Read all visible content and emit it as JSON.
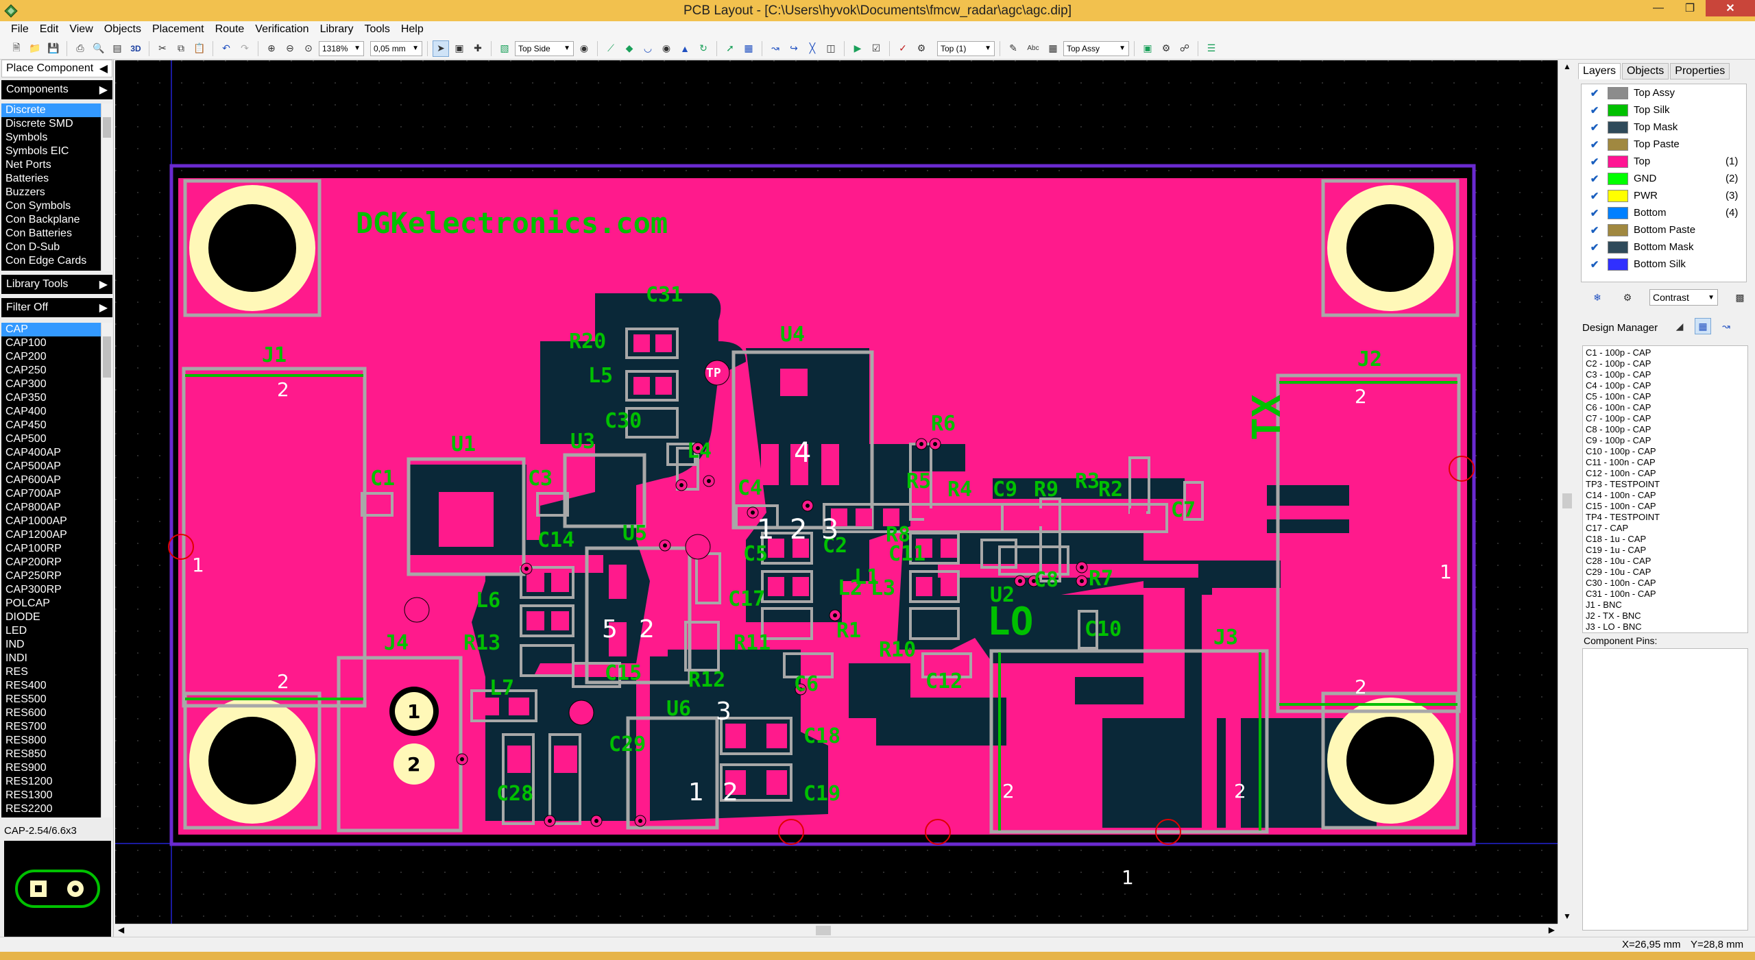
{
  "window": {
    "title": "PCB Layout - [C:\\Users\\hyvok\\Documents\\fmcw_radar\\agc\\agc.dip]"
  },
  "menu": [
    "File",
    "Edit",
    "View",
    "Objects",
    "Placement",
    "Route",
    "Verification",
    "Library",
    "Tools",
    "Help"
  ],
  "toolbar": {
    "zoom": "1318%",
    "grid": "0,05 mm",
    "view_3d": "3D",
    "side": "Top Side",
    "layer": "Top (1)",
    "assy": "Top Assy",
    "abc": "Abc"
  },
  "left_panel": {
    "place_component": "Place Component",
    "components_header": "Components",
    "categories": [
      "Discrete",
      "Discrete SMD",
      "Symbols",
      "Symbols EIC",
      "Net Ports",
      "Batteries",
      "Buzzers",
      "Con Symbols",
      "Con Backplane",
      "Con Batteries",
      "Con D-Sub",
      "Con Edge Cards"
    ],
    "selected_category": "Discrete",
    "library_tools": "Library Tools",
    "filter": "Filter Off",
    "parts": [
      "CAP",
      "CAP100",
      "CAP200",
      "CAP250",
      "CAP300",
      "CAP350",
      "CAP400",
      "CAP450",
      "CAP500",
      "CAP400AP",
      "CAP500AP",
      "CAP600AP",
      "CAP700AP",
      "CAP800AP",
      "CAP1000AP",
      "CAP1200AP",
      "CAP100RP",
      "CAP200RP",
      "CAP250RP",
      "CAP300RP",
      "POLCAP",
      "DIODE",
      "LED",
      "IND",
      "INDI",
      "RES",
      "RES400",
      "RES500",
      "RES600",
      "RES700",
      "RES800",
      "RES850",
      "RES900",
      "RES1200",
      "RES1300",
      "RES2200"
    ],
    "selected_part": "CAP",
    "preview_label": "CAP-2.54/6.6x3"
  },
  "board": {
    "watermark": "DGKelectronics.com",
    "tx_label": "TX",
    "lo_label": "LO",
    "refdes": [
      "J1",
      "J2",
      "J3",
      "J4",
      "U1",
      "U2",
      "U3",
      "U4",
      "U5",
      "U6",
      "C1",
      "C2",
      "C3",
      "C4",
      "C5",
      "C6",
      "C7",
      "C8",
      "C9",
      "C10",
      "C11",
      "C12",
      "C14",
      "C15",
      "C17",
      "C18",
      "C19",
      "C28",
      "C29",
      "C30",
      "C31",
      "R1",
      "R2",
      "R3",
      "R4",
      "R5",
      "R6",
      "R7",
      "R8",
      "R9",
      "R10",
      "R11",
      "R12",
      "R13",
      "R20",
      "L1",
      "L2",
      "L3",
      "L4",
      "L5",
      "L6",
      "L7",
      "TP"
    ],
    "pads": [
      "1",
      "2",
      "3",
      "4",
      "5"
    ]
  },
  "right_panel": {
    "tabs": [
      "Layers",
      "Objects",
      "Properties"
    ],
    "active_tab": "Layers",
    "layers": [
      {
        "name": "Top Assy",
        "color": "#8c8c8c",
        "num": ""
      },
      {
        "name": "Top Silk",
        "color": "#00c000",
        "num": ""
      },
      {
        "name": "Top Mask",
        "color": "#2f4a5a",
        "num": ""
      },
      {
        "name": "Top Paste",
        "color": "#a08840",
        "num": ""
      },
      {
        "name": "Top",
        "color": "#ff1493",
        "num": "(1)"
      },
      {
        "name": "GND",
        "color": "#00ff00",
        "num": "(2)"
      },
      {
        "name": "PWR",
        "color": "#ffff00",
        "num": "(3)"
      },
      {
        "name": "Bottom",
        "color": "#0080ff",
        "num": "(4)"
      },
      {
        "name": "Bottom Paste",
        "color": "#a08840",
        "num": ""
      },
      {
        "name": "Bottom Mask",
        "color": "#2f4a5a",
        "num": ""
      },
      {
        "name": "Bottom Silk",
        "color": "#3030ff",
        "num": ""
      }
    ],
    "contrast": "Contrast",
    "design_manager": "Design Manager",
    "components": [
      "C1 - 100p - CAP",
      "C2 - 100p - CAP",
      "C3 - 100p - CAP",
      "C4 - 100p - CAP",
      "C5 - 100n - CAP",
      "C6 - 100n - CAP",
      "C7 - 100p - CAP",
      "C8 - 100p - CAP",
      "C9 - 100p - CAP",
      "C10 - 100p - CAP",
      "C11 - 100n - CAP",
      "C12 - 100n - CAP",
      "TP3 - TESTPOINT",
      "C14 - 100n - CAP",
      "C15 - 100n - CAP",
      "TP4 - TESTPOINT",
      "C17 - CAP",
      "C18 - 1u - CAP",
      "C19 - 1u - CAP",
      "C28 - 10u - CAP",
      "C29 - 10u - CAP",
      "C30 - 100n - CAP",
      "C31 - 100n - CAP",
      "J1 - BNC",
      "J2 - TX - BNC",
      "J3 - LO - BNC"
    ],
    "component_pins": "Component Pins:"
  },
  "status": {
    "x": "X=26,95 mm",
    "y": "Y=28,8 mm"
  }
}
